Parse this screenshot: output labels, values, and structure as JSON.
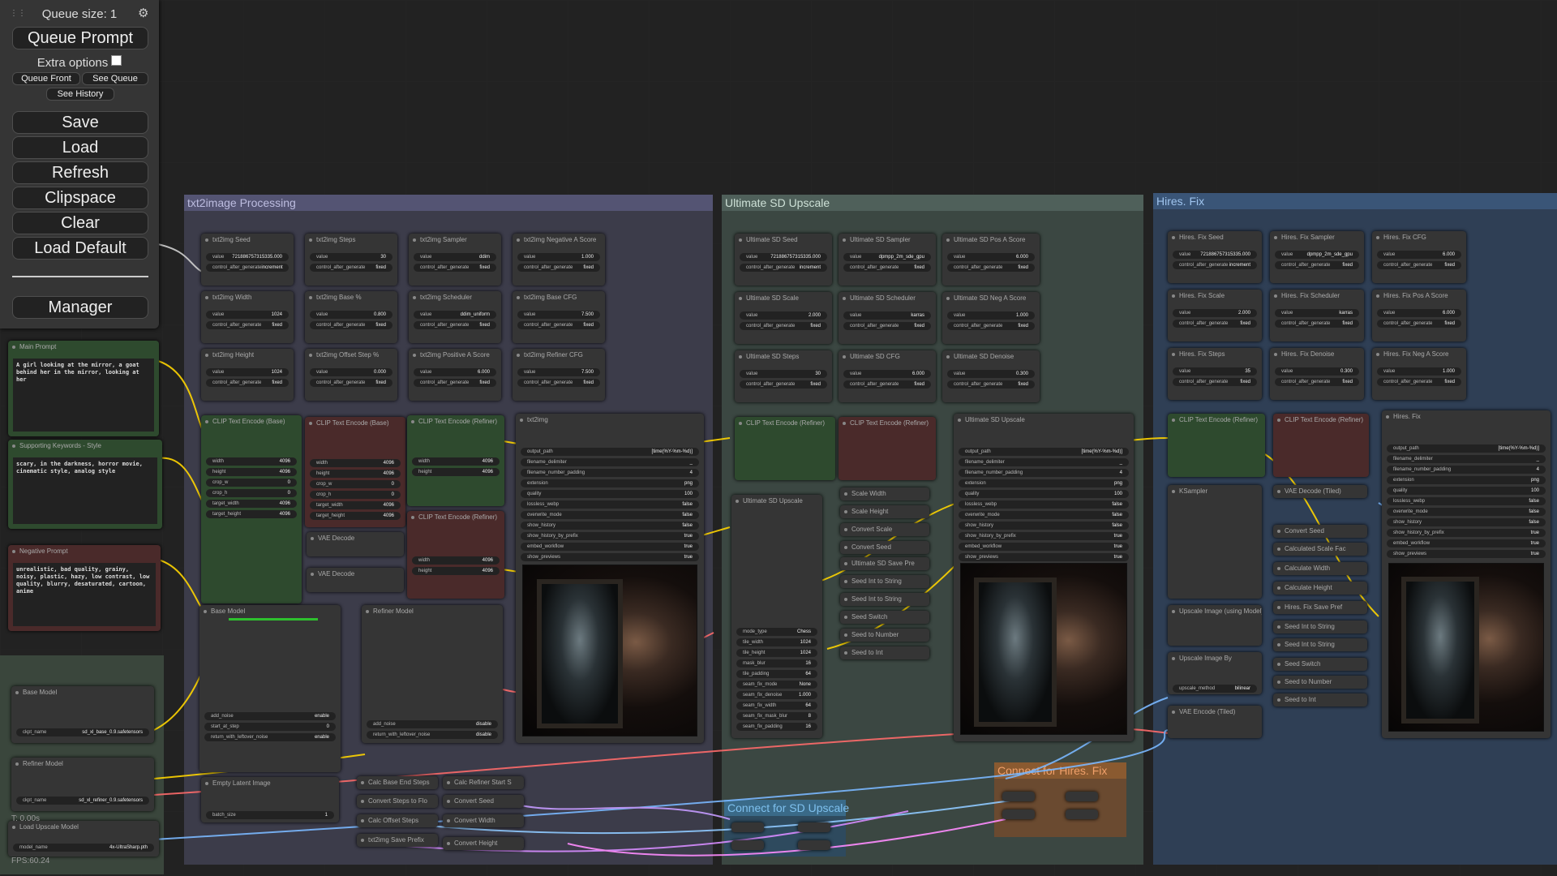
{
  "menu": {
    "queue_size": "Queue size: 1",
    "queue_prompt": "Queue Prompt",
    "extra_options": "Extra options",
    "queue_front": "Queue Front",
    "see_queue": "See Queue",
    "see_history": "See History",
    "save": "Save",
    "load": "Load",
    "refresh": "Refresh",
    "clipspace": "Clipspace",
    "clear": "Clear",
    "load_default": "Load Default",
    "manager": "Manager"
  },
  "groups": {
    "txt2image": "txt2image Processing",
    "ultimate": "Ultimate SD Upscale",
    "hires": "Hires. Fix",
    "connect_upscale": "Connect for SD Upscale",
    "connect_hires": "Connect for Hires. Fix"
  },
  "prompts": {
    "main_title": "Main Prompt",
    "main_text": "A girl looking at the mirror, a goat behind her in the mirror, looking at her",
    "style_title": "Supporting Keywords - Style",
    "style_text": "scary, in the darkness, horror movie, cinematic style, analog style",
    "neg_title": "Negative Prompt",
    "neg_text": "unrealistic, bad quality, grainy, noisy, plastic, hazy, low contrast, low quality, blurry, desaturated, cartoon, anime"
  },
  "loaders": {
    "base_title": "Base Model",
    "base_label": "ckpt_name",
    "base_value": "sd_xl_base_0.9.safetensors",
    "refiner_title": "Refiner Model",
    "refiner_label": "ckpt_name",
    "refiner_value": "sd_xl_refiner_0.9.safetensors",
    "upscale_title": "Load Upscale Model",
    "upscale_label": "model_name",
    "upscale_value": "4x-UltraSharp.pth"
  },
  "status": {
    "t": "T: 0.00s",
    "fps": "FPS:60.24"
  },
  "txt2img_nodes": [
    {
      "title": "txt2img Seed",
      "rows": [
        [
          "value",
          "721886757315335.000"
        ],
        [
          "control_after_generate",
          "increment"
        ]
      ]
    },
    {
      "title": "txt2img Steps",
      "rows": [
        [
          "value",
          "30"
        ],
        [
          "control_after_generate",
          "fixed"
        ]
      ]
    },
    {
      "title": "txt2img Sampler",
      "rows": [
        [
          "value",
          "ddim"
        ],
        [
          "control_after_generate",
          "fixed"
        ]
      ]
    },
    {
      "title": "txt2img Negative A Score",
      "rows": [
        [
          "value",
          "1.000"
        ],
        [
          "control_after_generate",
          "fixed"
        ]
      ]
    },
    {
      "title": "txt2img Width",
      "rows": [
        [
          "value",
          "1024"
        ],
        [
          "control_after_generate",
          "fixed"
        ]
      ]
    },
    {
      "title": "txt2img Base %",
      "rows": [
        [
          "value",
          "0.800"
        ],
        [
          "control_after_generate",
          "fixed"
        ]
      ]
    },
    {
      "title": "txt2img Scheduler",
      "rows": [
        [
          "value",
          "ddim_uniform"
        ],
        [
          "control_after_generate",
          "fixed"
        ]
      ]
    },
    {
      "title": "txt2img Base CFG",
      "rows": [
        [
          "value",
          "7.500"
        ],
        [
          "control_after_generate",
          "fixed"
        ]
      ]
    },
    {
      "title": "txt2img Height",
      "rows": [
        [
          "value",
          "1024"
        ],
        [
          "control_after_generate",
          "fixed"
        ]
      ]
    },
    {
      "title": "txt2img Offset Step %",
      "rows": [
        [
          "value",
          "0.000"
        ],
        [
          "control_after_generate",
          "fixed"
        ]
      ]
    },
    {
      "title": "txt2img Positive A Score",
      "rows": [
        [
          "value",
          "6.000"
        ],
        [
          "control_after_generate",
          "fixed"
        ]
      ]
    },
    {
      "title": "txt2img Refiner CFG",
      "rows": [
        [
          "value",
          "7.500"
        ],
        [
          "control_after_generate",
          "fixed"
        ]
      ]
    }
  ],
  "clip_base": {
    "title": "CLIP Text Encode (Base)",
    "rows": [
      [
        "width",
        "4096"
      ],
      [
        "height",
        "4096"
      ],
      [
        "crop_w",
        "0"
      ],
      [
        "crop_h",
        "0"
      ],
      [
        "target_width",
        "4096"
      ],
      [
        "target_height",
        "4096"
      ]
    ]
  },
  "clip_refiner": {
    "title": "CLIP Text Encode (Refiner)",
    "rows": [
      [
        "width",
        "4096"
      ],
      [
        "height",
        "4096"
      ]
    ]
  },
  "vae_decode": "VAE Decode",
  "save_node": {
    "title": "txt2img",
    "rows": [
      [
        "output_path",
        "[time(%Y-%m-%d)]"
      ],
      [
        "filename_delimiter",
        "_"
      ],
      [
        "filename_number_padding",
        "4"
      ],
      [
        "extension",
        "png"
      ],
      [
        "quality",
        "100"
      ],
      [
        "lossless_webp",
        "false"
      ],
      [
        "overwrite_mode",
        "false"
      ],
      [
        "show_history",
        "false"
      ],
      [
        "show_history_by_prefix",
        "true"
      ],
      [
        "embed_workflow",
        "true"
      ],
      [
        "show_previews",
        "true"
      ]
    ]
  },
  "base_sampler": {
    "title": "Base Model",
    "rows": [
      [
        "add_noise",
        "enable"
      ],
      [
        "start_at_step",
        "0"
      ],
      [
        "return_with_leftover_noise",
        "enable"
      ]
    ]
  },
  "refiner_sampler": {
    "title": "Refiner Model",
    "rows": [
      [
        "add_noise",
        "disable"
      ],
      [
        "return_with_leftover_noise",
        "disable"
      ]
    ]
  },
  "latent": {
    "title": "Empty Latent Image",
    "rows": [
      [
        "batch_size",
        "1"
      ]
    ]
  },
  "small_nodes": [
    "Calc Base End Steps",
    "Calc Refiner Start S",
    "Convert Steps to Flo",
    "Convert Seed",
    "Calc Offset Steps",
    "Convert Width",
    "txt2img Save Prefix",
    "Convert Height"
  ],
  "usd_nodes": [
    {
      "title": "Ultimate SD Seed",
      "rows": [
        [
          "value",
          "721886757315335.000"
        ],
        [
          "control_after_generate",
          "increment"
        ]
      ]
    },
    {
      "title": "Ultimate SD Sampler",
      "rows": [
        [
          "value",
          "dpmpp_2m_sde_gpu"
        ],
        [
          "control_after_generate",
          "fixed"
        ]
      ]
    },
    {
      "title": "Ultimate SD Pos A Score",
      "rows": [
        [
          "value",
          "6.000"
        ],
        [
          "control_after_generate",
          "fixed"
        ]
      ]
    },
    {
      "title": "Ultimate SD Scale",
      "rows": [
        [
          "value",
          "2.000"
        ],
        [
          "control_after_generate",
          "fixed"
        ]
      ]
    },
    {
      "title": "Ultimate SD Scheduler",
      "rows": [
        [
          "value",
          "karras"
        ],
        [
          "control_after_generate",
          "fixed"
        ]
      ]
    },
    {
      "title": "Ultimate SD Neg A Score",
      "rows": [
        [
          "value",
          "1.000"
        ],
        [
          "control_after_generate",
          "fixed"
        ]
      ]
    },
    {
      "title": "Ultimate SD Steps",
      "rows": [
        [
          "value",
          "30"
        ],
        [
          "control_after_generate",
          "fixed"
        ]
      ]
    },
    {
      "title": "Ultimate SD CFG",
      "rows": [
        [
          "value",
          "6.000"
        ],
        [
          "control_after_generate",
          "fixed"
        ]
      ]
    },
    {
      "title": "Ultimate SD Denoise",
      "rows": [
        [
          "value",
          "0.300"
        ],
        [
          "control_after_generate",
          "fixed"
        ]
      ]
    }
  ],
  "usd_main": {
    "title": "Ultimate SD Upscale",
    "rows": [
      [
        "mode_type",
        "Chess"
      ],
      [
        "tile_width",
        "1024"
      ],
      [
        "tile_height",
        "1024"
      ],
      [
        "mask_blur",
        "16"
      ],
      [
        "tile_padding",
        "64"
      ],
      [
        "seam_fix_mode",
        "None"
      ],
      [
        "seam_fix_denoise",
        "1.000"
      ],
      [
        "seam_fix_width",
        "64"
      ],
      [
        "seam_fix_mask_blur",
        "8"
      ],
      [
        "seam_fix_padding",
        "16"
      ]
    ]
  },
  "usd_save": {
    "title": "Ultimate SD Upscale",
    "rows": [
      [
        "output_path",
        "[time(%Y-%m-%d)]"
      ],
      [
        "filename_delimiter",
        "_"
      ],
      [
        "filename_number_padding",
        "4"
      ],
      [
        "extension",
        "png"
      ],
      [
        "quality",
        "100"
      ],
      [
        "lossless_webp",
        "false"
      ],
      [
        "overwrite_mode",
        "false"
      ],
      [
        "show_history",
        "false"
      ],
      [
        "show_history_by_prefix",
        "true"
      ],
      [
        "embed_workflow",
        "true"
      ],
      [
        "show_previews",
        "true"
      ]
    ]
  },
  "usd_small": [
    "Scale Width",
    "Scale Height",
    "Convert Scale",
    "Convert Seed",
    "Ultimate SD Save Pre",
    "Seed Int to String",
    "Seed Int to String",
    "Seed Switch",
    "Seed to Number",
    "Seed to Int"
  ],
  "hires_nodes": [
    {
      "title": "Hires. Fix Seed",
      "rows": [
        [
          "value",
          "721886757315335.000"
        ],
        [
          "control_after_generate",
          "increment"
        ]
      ]
    },
    {
      "title": "Hires. Fix Sampler",
      "rows": [
        [
          "value",
          "dpmpp_2m_sde_gpu"
        ],
        [
          "control_after_generate",
          "fixed"
        ]
      ]
    },
    {
      "title": "Hires. Fix CFG",
      "rows": [
        [
          "value",
          "6.000"
        ],
        [
          "control_after_generate",
          "fixed"
        ]
      ]
    },
    {
      "title": "Hires. Fix Scale",
      "rows": [
        [
          "value",
          "2.000"
        ],
        [
          "control_after_generate",
          "fixed"
        ]
      ]
    },
    {
      "title": "Hires. Fix Scheduler",
      "rows": [
        [
          "value",
          "karras"
        ],
        [
          "control_after_generate",
          "fixed"
        ]
      ]
    },
    {
      "title": "Hires. Fix Pos A Score",
      "rows": [
        [
          "value",
          "6.000"
        ],
        [
          "control_after_generate",
          "fixed"
        ]
      ]
    },
    {
      "title": "Hires. Fix Steps",
      "rows": [
        [
          "value",
          "35"
        ],
        [
          "control_after_generate",
          "fixed"
        ]
      ]
    },
    {
      "title": "Hires. Fix Denoise",
      "rows": [
        [
          "value",
          "0.300"
        ],
        [
          "control_after_generate",
          "fixed"
        ]
      ]
    },
    {
      "title": "Hires. Fix Neg A Score",
      "rows": [
        [
          "value",
          "1.000"
        ],
        [
          "control_after_generate",
          "fixed"
        ]
      ]
    }
  ],
  "hires_save": {
    "title": "Hires. Fix",
    "rows": [
      [
        "output_path",
        "[time(%Y-%m-%d)]"
      ],
      [
        "filename_delimiter",
        "_"
      ],
      [
        "filename_number_padding",
        "4"
      ],
      [
        "extension",
        "png"
      ],
      [
        "quality",
        "100"
      ],
      [
        "lossless_webp",
        "false"
      ],
      [
        "overwrite_mode",
        "false"
      ],
      [
        "show_history",
        "false"
      ],
      [
        "show_history_by_prefix",
        "true"
      ],
      [
        "embed_workflow",
        "true"
      ],
      [
        "show_previews",
        "true"
      ]
    ]
  },
  "hires_small": [
    "VAE Decode (Tiled)",
    "Convert Seed",
    "Calculated Scale Fac",
    "Calculate Width",
    "Calculate Height",
    "Hires. Fix Save Pref",
    "Seed Int to String",
    "Seed Int to String",
    "Seed Switch",
    "Seed to Number",
    "Seed to Int"
  ],
  "hires_misc": {
    "clip1": "CLIP Text Encode (Refiner)",
    "clip2": "CLIP Text Encode (Refiner)",
    "ksampler": "KSampler",
    "upscale_model": "Upscale Image (using Model)",
    "upscale_by": "Upscale Image By",
    "upscale_method_label": "upscale_method",
    "upscale_method_value": "bilinear",
    "vae_tiled": "VAE Encode (Tiled)"
  },
  "colors": {
    "group_txt2img": "#3c3c4a",
    "group_upscale": "#3b4742",
    "group_hires": "#2f3f55",
    "clip_green": "#2e4a2e",
    "clip_red": "#4a2a2a",
    "connect_upscale": "#2e4a5e",
    "connect_hires": "#7a4a2a"
  }
}
